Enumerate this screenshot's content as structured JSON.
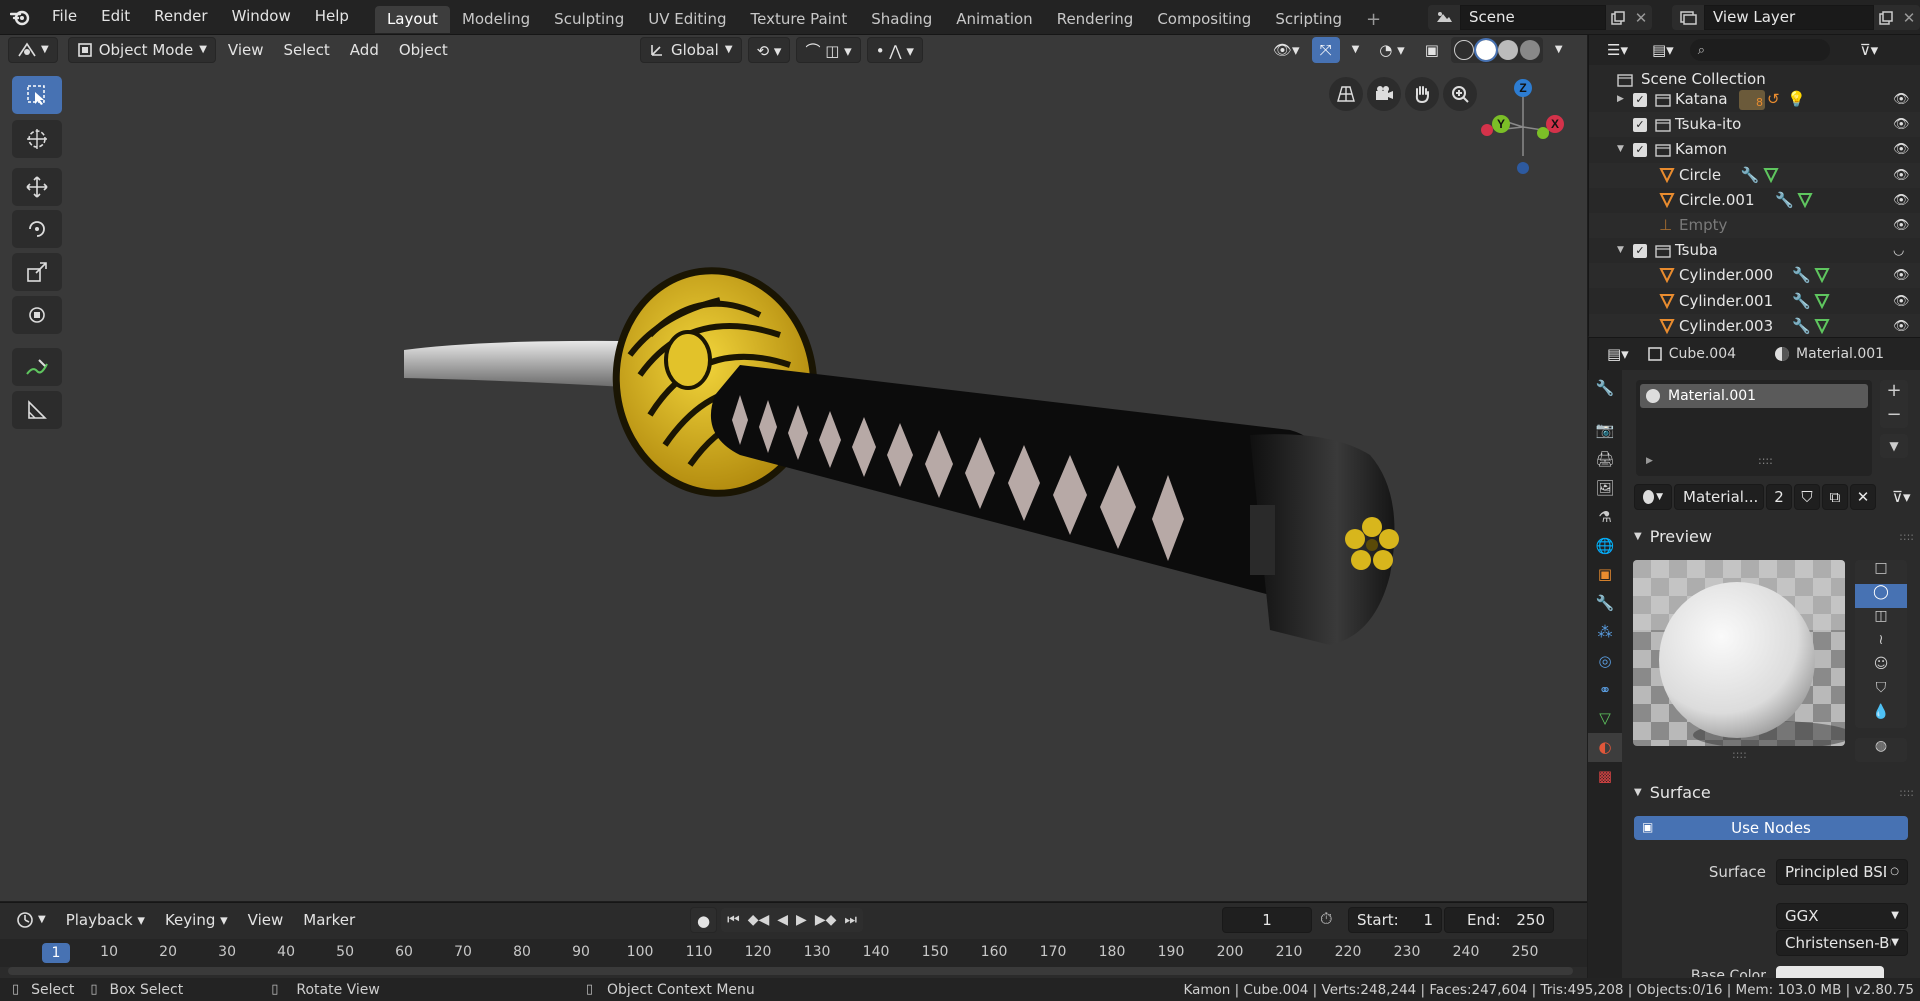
{
  "topbar": {
    "menus": [
      "File",
      "Edit",
      "Render",
      "Window",
      "Help"
    ],
    "workspaces": [
      "Layout",
      "Modeling",
      "Sculpting",
      "UV Editing",
      "Texture Paint",
      "Shading",
      "Animation",
      "Rendering",
      "Compositing",
      "Scripting"
    ],
    "active_workspace": "Layout",
    "add_tab": "+",
    "scene": "Scene",
    "view_layer": "View Layer"
  },
  "viewport": {
    "mode": "Object Mode",
    "menus": [
      "View",
      "Select",
      "Add",
      "Object"
    ],
    "orientation": "Global",
    "gizmo_axes": {
      "z": "Z",
      "y": "Y",
      "x": "X"
    }
  },
  "outliner": {
    "root": "Scene Collection",
    "items": [
      {
        "label": "Katana",
        "kind": "collection"
      },
      {
        "label": "Tsuka-ito",
        "kind": "collection"
      },
      {
        "label": "Kamon",
        "kind": "collection"
      },
      {
        "label": "Circle",
        "kind": "mesh"
      },
      {
        "label": "Circle.001",
        "kind": "mesh"
      },
      {
        "label": "Empty",
        "kind": "empty"
      },
      {
        "label": "Tsuba",
        "kind": "collection"
      },
      {
        "label": "Cylinder.000",
        "kind": "mesh"
      },
      {
        "label": "Cylinder.001",
        "kind": "mesh"
      },
      {
        "label": "Cylinder.003",
        "kind": "mesh"
      }
    ],
    "katana_badge": "8"
  },
  "properties": {
    "object": "Cube.004",
    "material": "Material.001",
    "slot": "Material.001",
    "material_field": "Material...",
    "users": "2",
    "preview_title": "Preview",
    "surface_title": "Surface",
    "use_nodes": "Use Nodes",
    "surface_label": "Surface",
    "surface_value": "Principled BSD",
    "distribution": "GGX",
    "subsurface": "Christensen-Bu...",
    "base_color_label": "Base Color"
  },
  "timeline": {
    "menus": [
      "Playback",
      "Keying",
      "View",
      "Marker"
    ],
    "current_frame": "1",
    "start_label": "Start:",
    "start": "1",
    "end_label": "End:",
    "end": "250",
    "ruler": [
      "1",
      "10",
      "20",
      "30",
      "40",
      "50",
      "60",
      "70",
      "80",
      "90",
      "100",
      "110",
      "120",
      "130",
      "140",
      "150",
      "160",
      "170",
      "180",
      "190",
      "200",
      "210",
      "220",
      "230",
      "240",
      "250"
    ]
  },
  "status": {
    "select": "Select",
    "box_select": "Box Select",
    "rotate": "Rotate View",
    "context": "Object Context Menu",
    "stats": "Kamon | Cube.004 | Verts:248,244 | Faces:247,604 | Tris:495,208 | Objects:0/16 | Mem: 103.0 MB | v2.80.75"
  },
  "colors": {
    "accent": "#4772b3",
    "gold": "#d8b61c",
    "orange_icon": "#e98c2f",
    "green_icon": "#5fc65f"
  }
}
